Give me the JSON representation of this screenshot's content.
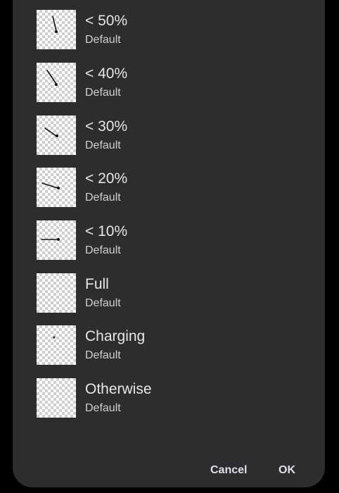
{
  "dialog": {
    "items": [
      {
        "title": "< 50%",
        "subtitle": "Default"
      },
      {
        "title": "< 40%",
        "subtitle": "Default"
      },
      {
        "title": "< 30%",
        "subtitle": "Default"
      },
      {
        "title": "< 20%",
        "subtitle": "Default"
      },
      {
        "title": "< 10%",
        "subtitle": "Default"
      },
      {
        "title": "Full",
        "subtitle": "Default"
      },
      {
        "title": "Charging",
        "subtitle": "Default"
      },
      {
        "title": "Otherwise",
        "subtitle": "Default"
      }
    ],
    "cancel_label": "Cancel",
    "ok_label": "OK"
  },
  "colors": {
    "dialog_background": "#2d2d2d",
    "text_primary": "#e6e6e6",
    "text_secondary": "#cfcfcf",
    "button_text": "#dde0e6",
    "checker_dark": "#cfcfcf",
    "checker_light": "#ffffff"
  },
  "icons": {
    "preview": "transparent-checkerboard-preview-with-needle"
  }
}
